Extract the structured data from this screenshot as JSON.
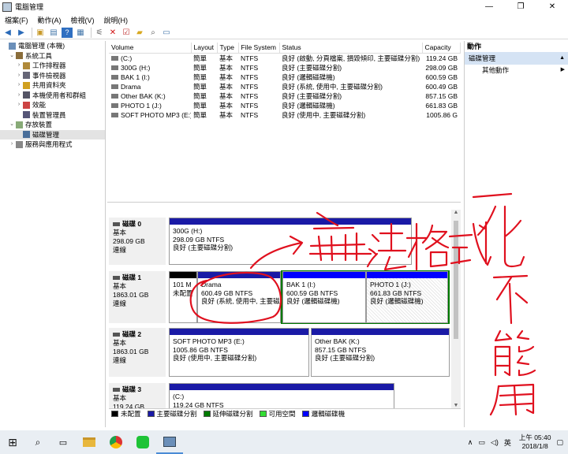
{
  "window": {
    "title": "電腦管理 (本機)",
    "title_short": "電腦管理"
  },
  "menu": [
    "檔案(F)",
    "動作(A)",
    "檢視(V)",
    "說明(H)"
  ],
  "tree": [
    {
      "label": "電腦管理 (本機)",
      "level": 0,
      "tw": "",
      "icon": "computer-icon"
    },
    {
      "label": "系統工具",
      "level": 1,
      "tw": "⌄",
      "icon": "tools-icon"
    },
    {
      "label": "工作排程器",
      "level": 2,
      "tw": "›",
      "icon": "clock-icon"
    },
    {
      "label": "事件檢視器",
      "level": 2,
      "tw": "›",
      "icon": "event-icon"
    },
    {
      "label": "共用資料夾",
      "level": 2,
      "tw": "›",
      "icon": "folder-icon"
    },
    {
      "label": "本機使用者和群組",
      "level": 2,
      "tw": "›",
      "icon": "users-icon"
    },
    {
      "label": "效能",
      "level": 2,
      "tw": "›",
      "icon": "performance-icon"
    },
    {
      "label": "裝置管理員",
      "level": 2,
      "tw": "",
      "icon": "device-icon"
    },
    {
      "label": "存放裝置",
      "level": 1,
      "tw": "⌄",
      "icon": "storage-icon"
    },
    {
      "label": "磁碟管理",
      "level": 2,
      "tw": "",
      "icon": "disk-icon",
      "selected": true
    },
    {
      "label": "服務與應用程式",
      "level": 1,
      "tw": "›",
      "icon": "services-icon"
    }
  ],
  "volume_table": {
    "headers": [
      "Volume",
      "Layout",
      "Type",
      "File System",
      "Status",
      "Capacity"
    ],
    "rows": [
      [
        "(C:)",
        "簡單",
        "基本",
        "NTFS",
        "良好 (啟動, 分頁檔案, 損毀傾印, 主要磁碟分割)",
        "119.24 GB"
      ],
      [
        "300G (H:)",
        "簡單",
        "基本",
        "NTFS",
        "良好 (主要磁碟分割)",
        "298.09 GB"
      ],
      [
        "BAK 1 (I:)",
        "簡單",
        "基本",
        "NTFS",
        "良好 (邏輯磁碟機)",
        "600.59 GB"
      ],
      [
        "Drama",
        "簡單",
        "基本",
        "NTFS",
        "良好 (系統, 使用中, 主要磁碟分割)",
        "600.49 GB"
      ],
      [
        "Other BAK  (K:)",
        "簡單",
        "基本",
        "NTFS",
        "良好 (主要磁碟分割)",
        "857.15 GB"
      ],
      [
        "PHOTO 1 (J:)",
        "簡單",
        "基本",
        "NTFS",
        "良好 (邏輯磁碟機)",
        "661.83 GB"
      ],
      [
        "SOFT PHOTO MP3 (E:)",
        "簡單",
        "基本",
        "NTFS",
        "良好 (使用中, 主要磁碟分割)",
        "1005.86 G"
      ]
    ]
  },
  "disks": [
    {
      "name": "磁碟 0",
      "type": "基本",
      "size": "298.09 GB",
      "state": "連線",
      "parts": [
        {
          "title": "300G  (H:)",
          "size": "298.09 GB NTFS",
          "status": "良好 (主要磁碟分割)"
        }
      ]
    },
    {
      "name": "磁碟 1",
      "type": "基本",
      "size": "1863.01 GB",
      "state": "連線",
      "parts": [
        {
          "title": "",
          "size": "101 M",
          "status": "未配置"
        },
        {
          "title": "Drama",
          "size": "600.49 GB NTFS",
          "status": "良好 (系統, 使用中, 主要磁"
        },
        {
          "title": "BAK 1  (I:)",
          "size": "600.59 GB NTFS",
          "status": "良好 (邏輯磁碟機)"
        },
        {
          "title": "PHOTO 1  (J:)",
          "size": "661.83 GB NTFS",
          "status": "良好 (邏輯磁碟機)"
        }
      ]
    },
    {
      "name": "磁碟 2",
      "type": "基本",
      "size": "1863.01 GB",
      "state": "連線",
      "parts": [
        {
          "title": "SOFT PHOTO MP3  (E:)",
          "size": "1005.86 GB NTFS",
          "status": "良好 (使用中, 主要磁碟分割)"
        },
        {
          "title": "Other BAK  (K:)",
          "size": "857.15 GB NTFS",
          "status": "良好 (主要磁碟分割)"
        }
      ]
    },
    {
      "name": "磁碟 3",
      "type": "基本",
      "size": "119.24 GB",
      "state": "",
      "parts": [
        {
          "title": "(C:)",
          "size": "119.24 GB NTFS",
          "status": ""
        }
      ]
    }
  ],
  "legend": [
    {
      "label": "未配置",
      "color": "#000000"
    },
    {
      "label": "主要磁碟分割",
      "color": "#1a1aa6"
    },
    {
      "label": "延伸磁碟分割",
      "color": "#007a00"
    },
    {
      "label": "可用空間",
      "color": "#33dd33"
    },
    {
      "label": "邏輯磁碟機",
      "color": "#0000ff"
    }
  ],
  "actions": {
    "header": "動作",
    "section": "磁碟管理",
    "more": "其他動作"
  },
  "annotation": {
    "handwriting": "無法格式化也不能用",
    "ink_color": "#e0101e"
  },
  "taskbar": {
    "ime": "英",
    "time": "上午 05:40",
    "date": "2018/1/8"
  }
}
